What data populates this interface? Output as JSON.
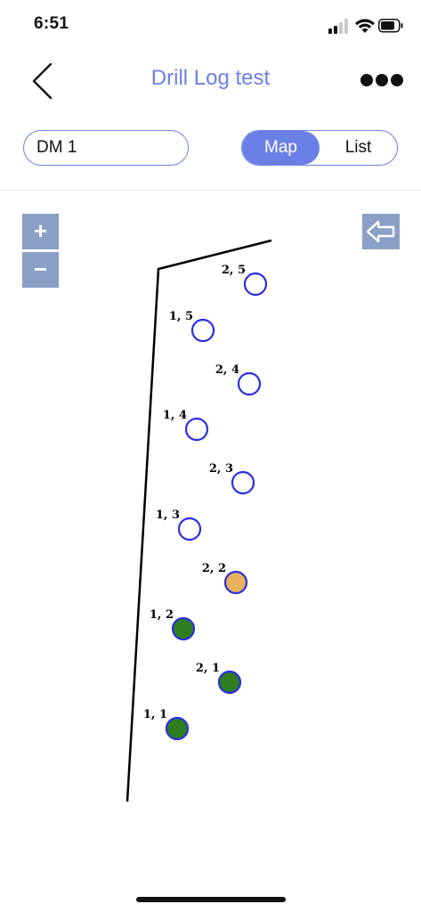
{
  "status_bar": {
    "time": "6:51"
  },
  "nav": {
    "title": "Drill Log test",
    "back_icon": "chevron-left-icon",
    "more_icon": "more-horizontal-icon"
  },
  "controls": {
    "dm_select": "DM 1",
    "view_modes": [
      "Map",
      "List"
    ],
    "active_view": "Map"
  },
  "map": {
    "zoom_in_label": "+",
    "zoom_out_label": "−",
    "export_icon": "arrow-left-icon",
    "colors": {
      "empty_fill": "#ffffff",
      "outline": "#2a2ee0",
      "complete": "#2e7d1e",
      "partial": "#e8b25a",
      "boundary": "#000000"
    },
    "holes": [
      {
        "label": "2, 5",
        "status": "empty"
      },
      {
        "label": "1, 5",
        "status": "empty"
      },
      {
        "label": "2, 4",
        "status": "empty"
      },
      {
        "label": "1, 4",
        "status": "empty"
      },
      {
        "label": "2, 3",
        "status": "empty"
      },
      {
        "label": "1, 3",
        "status": "empty"
      },
      {
        "label": "2, 2",
        "status": "partial"
      },
      {
        "label": "1, 2",
        "status": "complete"
      },
      {
        "label": "2, 1",
        "status": "complete"
      },
      {
        "label": "1, 1",
        "status": "complete"
      }
    ]
  }
}
